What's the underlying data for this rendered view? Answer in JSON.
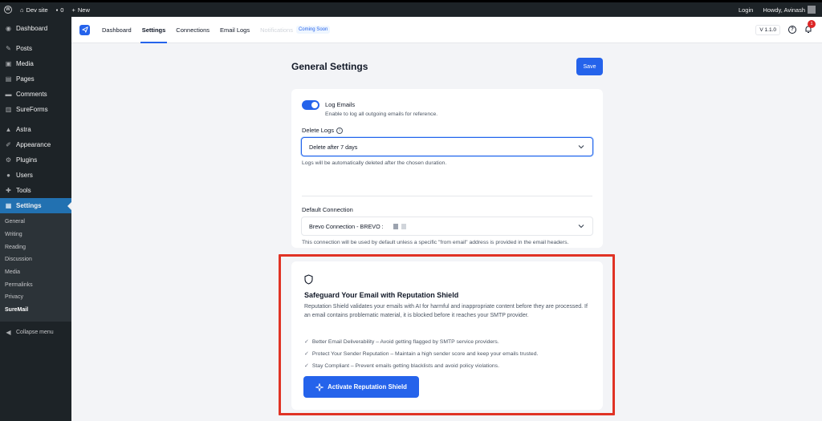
{
  "adminbar": {
    "site_name": "Dev site",
    "comments_count": "0",
    "new_label": "New",
    "login_label": "Login",
    "howdy_label": "Howdy, Avinash"
  },
  "sidebar": {
    "items": [
      {
        "label": "Dashboard",
        "icon": "dashboard-icon"
      },
      {
        "label": "Posts",
        "icon": "pin-icon"
      },
      {
        "label": "Media",
        "icon": "media-icon"
      },
      {
        "label": "Pages",
        "icon": "pages-icon"
      },
      {
        "label": "Comments",
        "icon": "comment-icon"
      },
      {
        "label": "SureForms",
        "icon": "sureforms-icon"
      },
      {
        "label": "Astra",
        "icon": "astra-icon"
      },
      {
        "label": "Appearance",
        "icon": "brush-icon"
      },
      {
        "label": "Plugins",
        "icon": "plugin-icon"
      },
      {
        "label": "Users",
        "icon": "user-icon"
      },
      {
        "label": "Tools",
        "icon": "wrench-icon"
      },
      {
        "label": "Settings",
        "icon": "settings-icon"
      }
    ],
    "submenu": [
      "General",
      "Writing",
      "Reading",
      "Discussion",
      "Media",
      "Permalinks",
      "Privacy",
      "SureMail"
    ],
    "collapse_label": "Collapse menu"
  },
  "topnav": {
    "tabs": [
      "Dashboard",
      "Settings",
      "Connections",
      "Email Logs"
    ],
    "disabled_tab": "Notifications",
    "coming_soon": "Coming Soon",
    "version": "V 1.1.0",
    "notification_count": "1"
  },
  "page": {
    "title": "General Settings",
    "save_label": "Save"
  },
  "log_emails": {
    "label": "Log Emails",
    "help": "Enable to log all outgoing emails for reference.",
    "enabled": true
  },
  "delete_logs": {
    "label": "Delete Logs",
    "value": "Delete after 7 days",
    "help": "Logs will be automatically deleted after the chosen duration."
  },
  "default_connection": {
    "label": "Default Connection",
    "value": "Brevo Connection - BREVO : ",
    "help": "This connection will be used by default unless a specific \"from email\" address is provided in the email headers."
  },
  "reputation_shield": {
    "title": "Safeguard Your Email with Reputation Shield",
    "description": "Reputation Shield validates your emails with AI for harmful and inappropriate content before they are processed. If an email contains problematic material, it is blocked before it reaches your SMTP provider.",
    "benefits": [
      "Better Email Deliverability – Avoid getting flagged by SMTP service providers.",
      "Protect Your Sender Reputation – Maintain a high sender score and keep your emails trusted.",
      "Stay Compliant – Prevent emails getting blacklists and avoid policy violations."
    ],
    "button_label": "Activate Reputation Shield"
  },
  "colors": {
    "primary": "#2563eb",
    "sidebar": "#1d2327",
    "active_menu": "#2271b1",
    "highlight": "#e03325"
  }
}
